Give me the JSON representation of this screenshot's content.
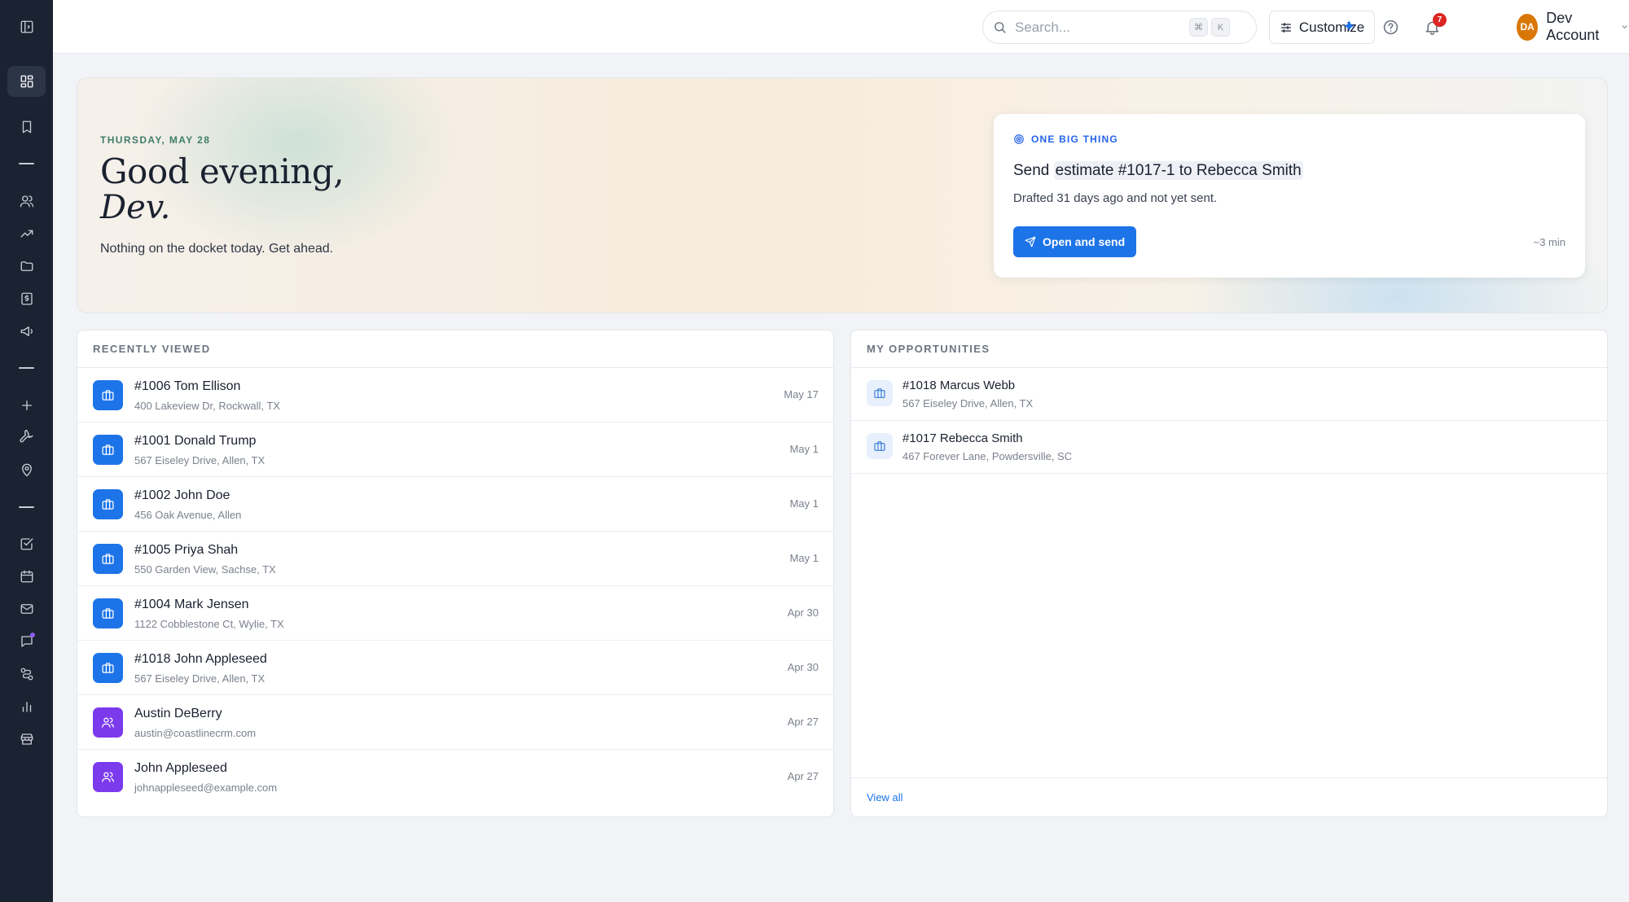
{
  "topbar": {
    "search_placeholder": "Search...",
    "kbd_mod": "⌘",
    "kbd_key": "K",
    "customize_label": "Customize",
    "notification_count": "7",
    "account_initials": "DA",
    "account_name": "Dev Account"
  },
  "hero": {
    "date": "THURSDAY, MAY 28",
    "greeting": "Good evening,",
    "name": "Dev.",
    "subtitle": "Nothing on the docket today. Get ahead."
  },
  "one_big_thing": {
    "tag": "ONE BIG THING",
    "title_prefix": "Send",
    "title_highlight": "estimate #1017-1 to Rebecca Smith",
    "description": "Drafted 31 days ago and not yet sent.",
    "button_label": "Open and send",
    "time_estimate": "~3 min"
  },
  "recently_viewed": {
    "heading": "RECENTLY VIEWED",
    "items": [
      {
        "title": "#1006 Tom Ellison",
        "subtitle": "400 Lakeview Dr, Rockwall, TX",
        "date": "May 17",
        "kind": "job"
      },
      {
        "title": "#1001 Donald Trump",
        "subtitle": "567 Eiseley Drive, Allen, TX",
        "date": "May 1",
        "kind": "job"
      },
      {
        "title": "#1002 John Doe",
        "subtitle": "456 Oak Avenue, Allen",
        "date": "May 1",
        "kind": "job"
      },
      {
        "title": "#1005 Priya Shah",
        "subtitle": "550 Garden View, Sachse, TX",
        "date": "May 1",
        "kind": "job"
      },
      {
        "title": "#1004 Mark Jensen",
        "subtitle": "1122 Cobblestone Ct, Wylie, TX",
        "date": "Apr 30",
        "kind": "job"
      },
      {
        "title": "#1018 John Appleseed",
        "subtitle": "567 Eiseley Drive, Allen, TX",
        "date": "Apr 30",
        "kind": "job"
      },
      {
        "title": "Austin DeBerry",
        "subtitle": "austin@coastlinecrm.com",
        "date": "Apr 27",
        "kind": "contact"
      },
      {
        "title": "John Appleseed",
        "subtitle": "johnappleseed@example.com",
        "date": "Apr 27",
        "kind": "contact"
      }
    ]
  },
  "my_opportunities": {
    "heading": "MY OPPORTUNITIES",
    "items": [
      {
        "title": "#1018 Marcus Webb",
        "subtitle": "567 Eiseley Drive, Allen, TX"
      },
      {
        "title": "#1017 Rebecca Smith",
        "subtitle": "467 Forever Lane, Powdersville, SC"
      }
    ],
    "view_all": "View all"
  },
  "colors": {
    "sidebar_bg": "#1b2231",
    "accent_blue": "#1d74e8",
    "contact_purple": "#7c3aed",
    "avatar_orange": "#d97706",
    "badge_red": "#dc2626"
  },
  "icons": {
    "sidebar": [
      "sidebar-toggle-icon",
      "dashboard-icon",
      "bookmark-icon",
      "users-icon",
      "trending-up-icon",
      "folder-icon",
      "invoice-icon",
      "megaphone-icon",
      "plus-icon",
      "wrench-icon",
      "map-pin-icon",
      "check-square-icon",
      "calendar-icon",
      "mail-icon",
      "message-icon",
      "route-icon",
      "bar-chart-icon",
      "store-icon"
    ]
  }
}
